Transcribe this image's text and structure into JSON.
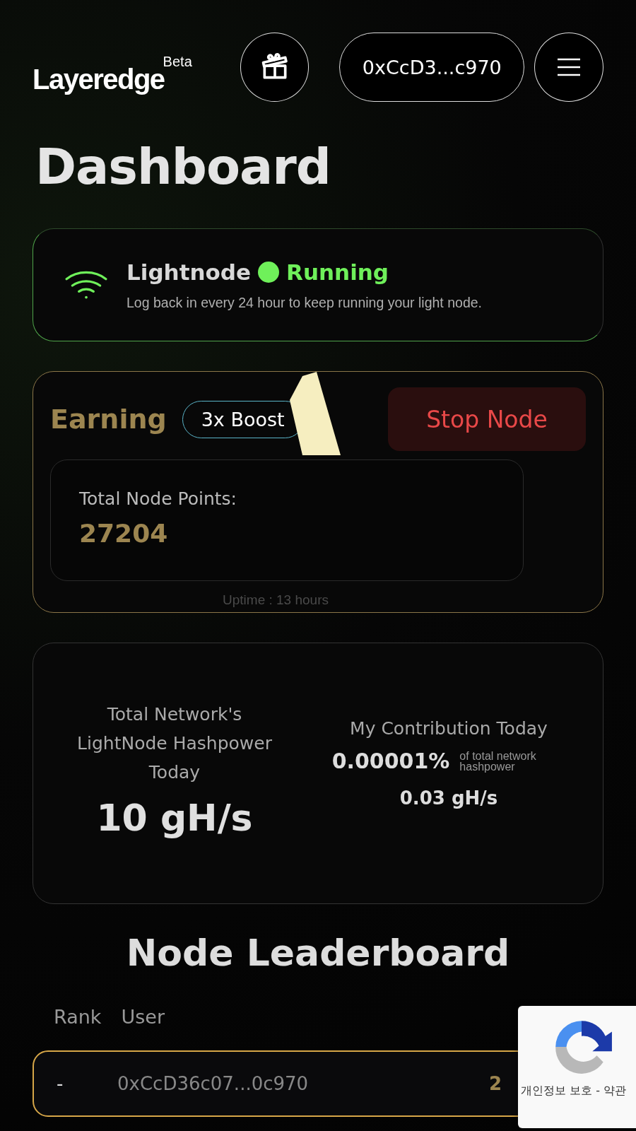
{
  "header": {
    "logo": "Layeredge",
    "logo_badge": "Beta",
    "wallet": "0xCcD3...c970"
  },
  "page_title": "Dashboard",
  "node_status": {
    "name": "Lightnode",
    "status": "Running",
    "running": true,
    "note": "Log back in every 24 hour to keep running your light node."
  },
  "earning": {
    "title": "Earning",
    "boost": "3x Boost",
    "action": "Stop Node",
    "points_label": "Total Node Points:",
    "points": "27204",
    "uptime": "Uptime : 13 hours"
  },
  "network": {
    "hashpower_label": "Total Network's LightNode Hashpower Today",
    "hashpower": "10 gH/s",
    "contribution_label": "My Contribution Today",
    "contribution_share": "0.00001%",
    "share_note": "of total network hashpower",
    "contribution_rate": "0.03 gH/s"
  },
  "leaderboard": {
    "title": "Node Leaderboard",
    "columns": [
      "Rank",
      "User"
    ],
    "rows": [
      {
        "rank": "-",
        "user": "0xCcD36c07...0c970",
        "column_3": "2",
        "selected": true
      }
    ]
  },
  "recaptcha": {
    "links": "개인정보 보호 - 약관"
  }
}
